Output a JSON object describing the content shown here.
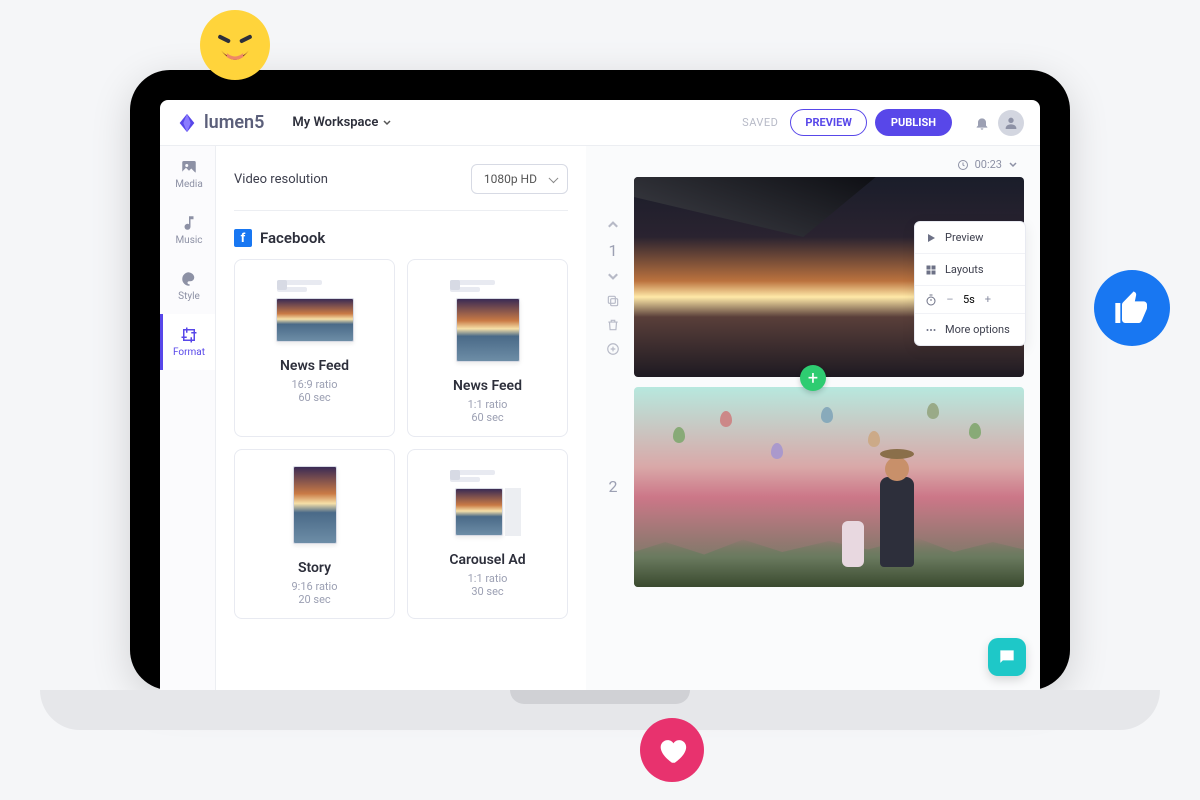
{
  "brand": "lumen5",
  "workspace": "My Workspace",
  "status": "SAVED",
  "buttons": {
    "preview": "PREVIEW",
    "publish": "PUBLISH"
  },
  "rail": [
    {
      "id": "media",
      "label": "Media"
    },
    {
      "id": "music",
      "label": "Music"
    },
    {
      "id": "style",
      "label": "Style"
    },
    {
      "id": "format",
      "label": "Format"
    }
  ],
  "resolution": {
    "label": "Video resolution",
    "value": "1080p HD"
  },
  "section": {
    "platform": "Facebook"
  },
  "formats": [
    {
      "title": "News Feed",
      "ratio": "16:9 ratio",
      "duration": "60 sec",
      "shape": "wide"
    },
    {
      "title": "News Feed",
      "ratio": "1:1 ratio",
      "duration": "60 sec",
      "shape": "square"
    },
    {
      "title": "Story",
      "ratio": "9:16 ratio",
      "duration": "20 sec",
      "shape": "tall"
    },
    {
      "title": "Carousel Ad",
      "ratio": "1:1 ratio",
      "duration": "30 sec",
      "shape": "carousel"
    }
  ],
  "timeline": {
    "total_time": "00:23"
  },
  "scenes": [
    {
      "number": "1"
    },
    {
      "number": "2"
    }
  ],
  "scene_menu": {
    "preview": "Preview",
    "layouts": "Layouts",
    "duration_value": "5s",
    "more": "More options"
  }
}
